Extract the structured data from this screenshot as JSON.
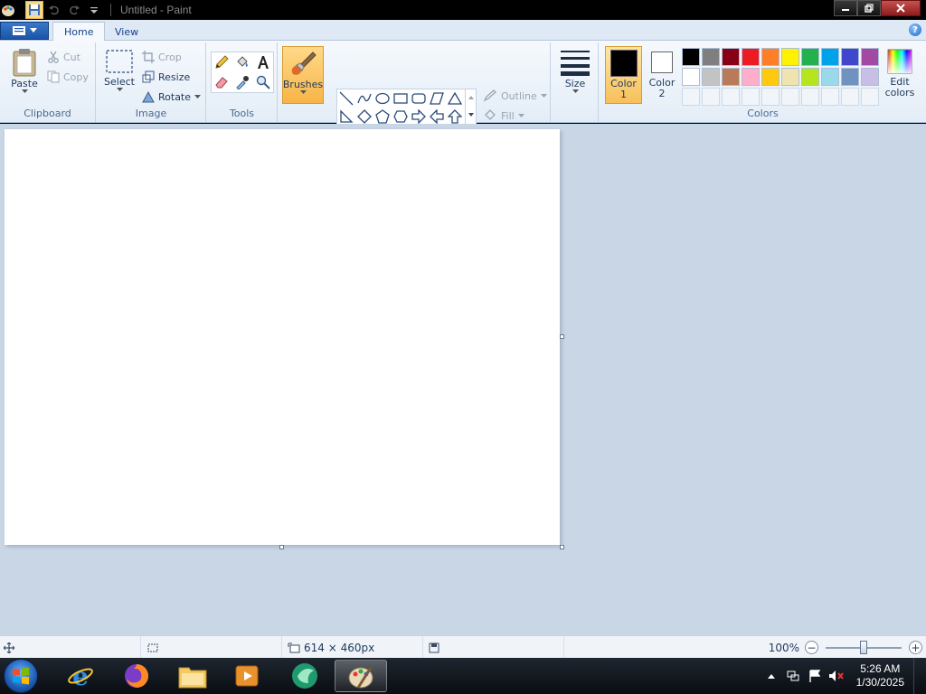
{
  "window": {
    "title": "Untitled - Paint"
  },
  "tabs": [
    {
      "label": "Home"
    },
    {
      "label": "View"
    }
  ],
  "help_label": "?",
  "ribbon": {
    "clipboard": {
      "label": "Clipboard",
      "paste": "Paste",
      "cut": "Cut",
      "copy": "Copy"
    },
    "image": {
      "label": "Image",
      "select": "Select",
      "crop": "Crop",
      "resize": "Resize",
      "rotate": "Rotate"
    },
    "tools": {
      "label": "Tools"
    },
    "brushes": {
      "label": "Brushes"
    },
    "shapes": {
      "label": "Shapes",
      "outline": "Outline",
      "fill": "Fill"
    },
    "size": {
      "label": "Size"
    },
    "colors": {
      "label": "Colors",
      "color1": "Color 1",
      "color2": "Color 2",
      "edit": "Edit colors",
      "color1_value": "#000000",
      "color2_value": "#ffffff",
      "palette_row1": [
        "#000000",
        "#7f7f7f",
        "#880015",
        "#ed1c24",
        "#ff7f27",
        "#fff200",
        "#22b14c",
        "#00a2e8",
        "#3f48cc",
        "#a349a4"
      ],
      "palette_row2": [
        "#ffffff",
        "#c3c3c3",
        "#b97a57",
        "#ffaec9",
        "#ffc90e",
        "#efe4b0",
        "#b5e61d",
        "#99d9ea",
        "#7092be",
        "#c8bfe7"
      ]
    }
  },
  "status": {
    "canvas_size": "614 × 460px",
    "zoom": "100%"
  },
  "taskbar": {
    "time": "5:26 AM",
    "date": "1/30/2025"
  }
}
